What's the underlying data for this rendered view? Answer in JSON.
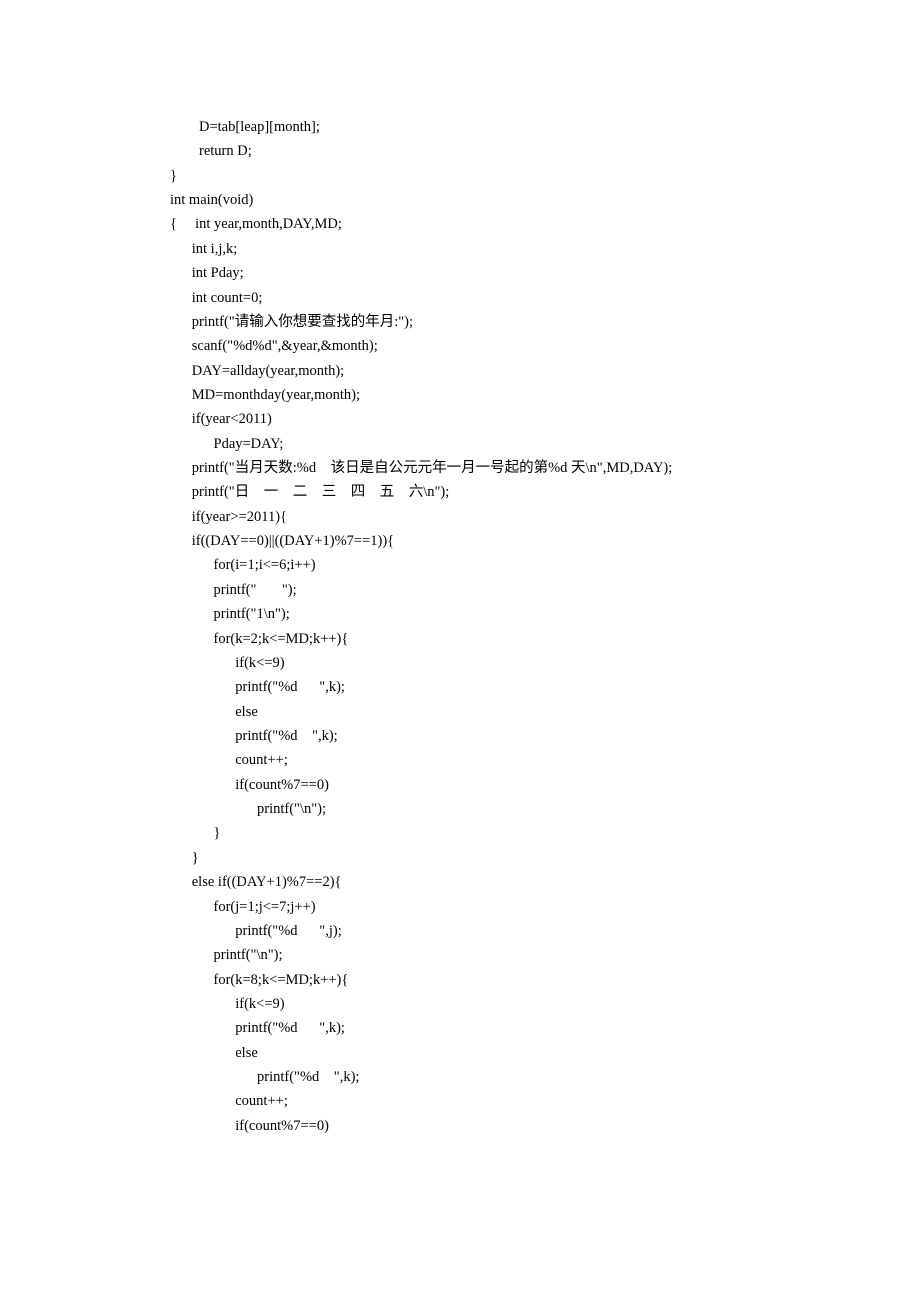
{
  "code_lines": [
    "        D=tab[leap][month];",
    "        return D;",
    "}",
    "int main(void)",
    "{     int year,month,DAY,MD;",
    "      int i,j,k;",
    "      int Pday;",
    "      int count=0;",
    "",
    "      printf(\"请输入你想要查找的年月:\");",
    "      scanf(\"%d%d\",&year,&month);",
    "      DAY=allday(year,month);",
    "      MD=monthday(year,month);",
    "      if(year<2011)",
    "            Pday=DAY;",
    "      printf(\"当月天数:%d    该日是自公元元年一月一号起的第%d 天\\n\",MD,DAY);",
    "      printf(\"日    一    二    三    四    五    六\\n\");",
    "      if(year>=2011){",
    "      if((DAY==0)||((DAY+1)%7==1)){",
    "            for(i=1;i<=6;i++)",
    "            printf(\"       \");",
    "            printf(\"1\\n\");",
    "            for(k=2;k<=MD;k++){",
    "                  if(k<=9)",
    "                  printf(\"%d      \",k);",
    "                  else",
    "                  printf(\"%d    \",k);",
    "                  count++;",
    "                  if(count%7==0)",
    "                        printf(\"\\n\");",
    "            }",
    "",
    "      }",
    "      else if((DAY+1)%7==2){",
    "            for(j=1;j<=7;j++)",
    "                  printf(\"%d      \",j);",
    "            printf(\"\\n\");",
    "            for(k=8;k<=MD;k++){",
    "                  if(k<=9)",
    "                  printf(\"%d      \",k);",
    "                  else",
    "                        printf(\"%d    \",k);",
    "                  count++;",
    "                  if(count%7==0)"
  ]
}
